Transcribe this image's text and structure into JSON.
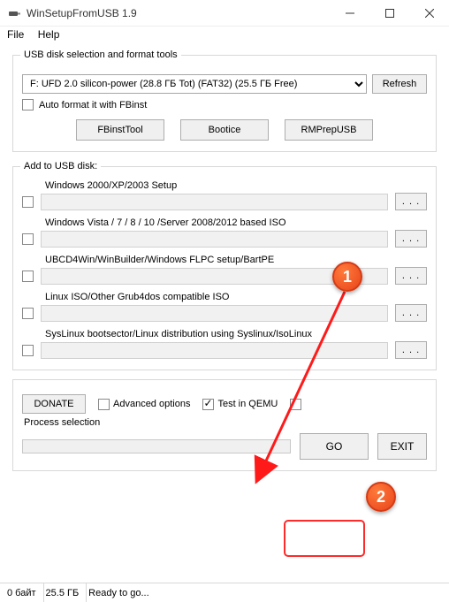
{
  "window": {
    "title": "WinSetupFromUSB 1.9"
  },
  "menu": {
    "file": "File",
    "help": "Help"
  },
  "usb_section": {
    "legend": "USB disk selection and format tools",
    "disk": "F: UFD 2.0 silicon-power (28.8 ГБ Tot) (FAT32) (25.5 ГБ Free)",
    "refresh": "Refresh",
    "autoformat": "Auto format it with FBinst",
    "btn_fbinst": "FBinstTool",
    "btn_bootice": "Bootice",
    "btn_rmprep": "RMPrepUSB"
  },
  "add_section": {
    "legend": "Add to USB disk:",
    "items": [
      {
        "label": "Windows 2000/XP/2003 Setup"
      },
      {
        "label": "Windows Vista / 7 / 8 / 10 /Server 2008/2012 based ISO"
      },
      {
        "label": "UBCD4Win/WinBuilder/Windows FLPC setup/BartPE"
      },
      {
        "label": "Linux ISO/Other Grub4dos compatible ISO"
      },
      {
        "label": "SysLinux bootsector/Linux distribution using Syslinux/IsoLinux"
      }
    ],
    "browse": ". . ."
  },
  "options": {
    "donate": "DONATE",
    "advanced": "Advanced options",
    "qemu": "Test in QEMU",
    "process_label": "Process selection",
    "go": "GO",
    "exit": "EXIT"
  },
  "status": {
    "c1": "0 байт",
    "c2": "25.5 ГБ",
    "c3": "Ready to go..."
  },
  "callouts": {
    "n1": "1",
    "n2": "2"
  }
}
